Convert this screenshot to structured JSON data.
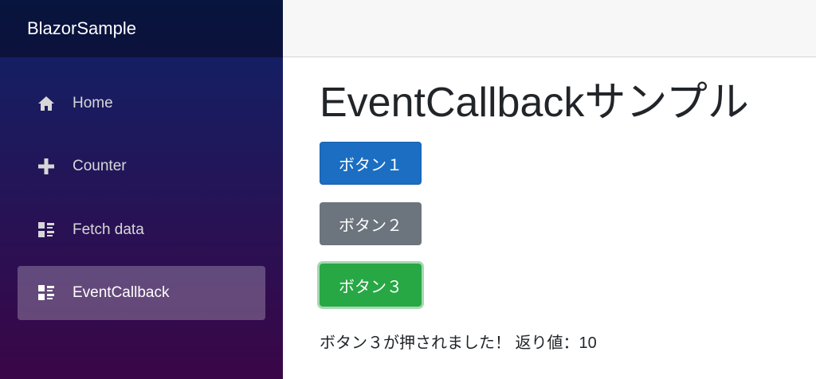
{
  "brand": "BlazorSample",
  "nav": [
    {
      "label": "Home",
      "icon": "home-icon",
      "active": false
    },
    {
      "label": "Counter",
      "icon": "plus-icon",
      "active": false
    },
    {
      "label": "Fetch data",
      "icon": "list-rich-icon",
      "active": false
    },
    {
      "label": "EventCallback",
      "icon": "list-rich-icon",
      "active": true
    }
  ],
  "page": {
    "title": "EventCallbackサンプル",
    "buttons": [
      {
        "label": "ボタン１",
        "style": "primary"
      },
      {
        "label": "ボタン２",
        "style": "secondary"
      },
      {
        "label": "ボタン３",
        "style": "success",
        "focused": true
      }
    ],
    "message": "ボタン３が押されました！ 返り値：10"
  },
  "colors": {
    "sidebar_gradient_top": "#0e2368",
    "sidebar_gradient_bottom": "#3a0647",
    "primary": "#1b6ec2",
    "secondary": "#6c757d",
    "success": "#28a745"
  }
}
